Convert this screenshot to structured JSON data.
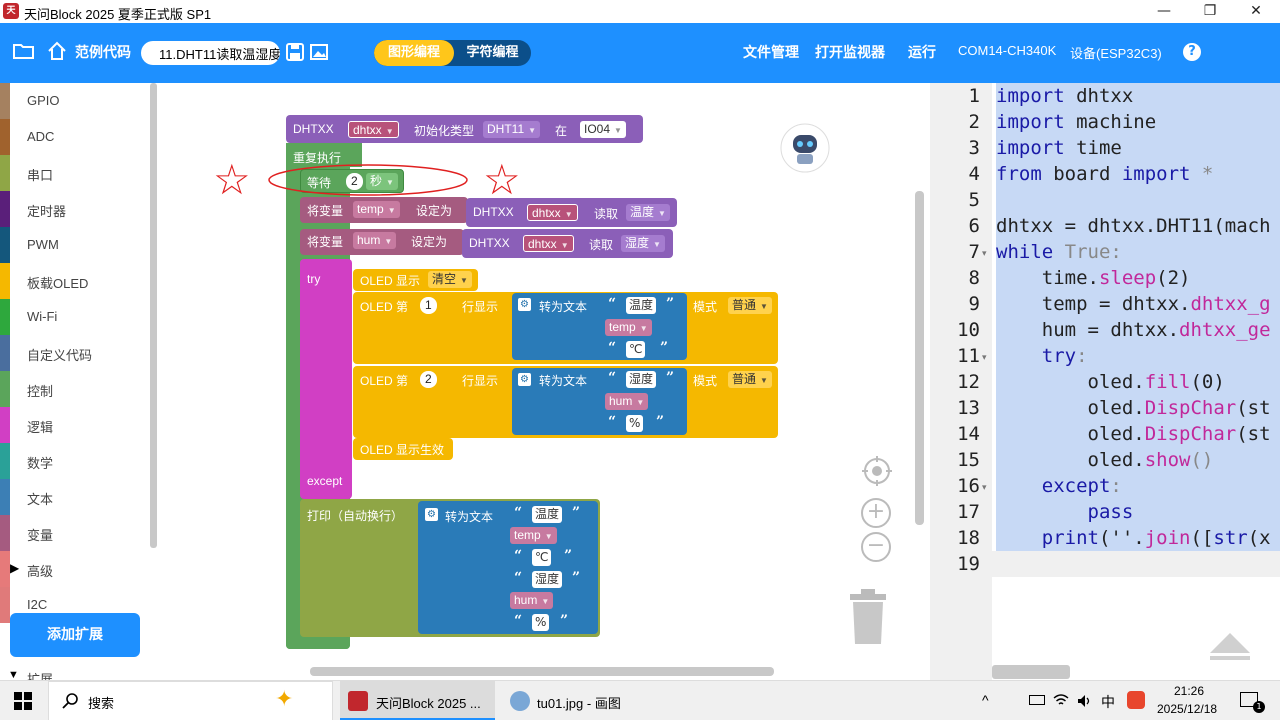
{
  "window": {
    "title": "天问Block 2025 夏季正式版 SP1",
    "logo_text": "天问",
    "minimize": "—",
    "restore": "❐",
    "close": "✕"
  },
  "toolbar": {
    "folder_icon": "folder-icon",
    "home_icon": "home-icon",
    "examples_label": "范例代码",
    "filename": "11.DHT11读取温湿度",
    "save_icon": "save-icon",
    "image_icon": "image-icon",
    "mode_graphic": "图形编程",
    "mode_text": "字符编程",
    "file_manage": "文件管理",
    "open_monitor": "打开监视器",
    "run": "运行",
    "port": "COM14-CH340K",
    "device": "设备(ESP32C3)",
    "help": "?"
  },
  "sidebar": {
    "items": [
      {
        "label": "GPIO",
        "color": "#a58160"
      },
      {
        "label": "ADC",
        "color": "#a0622d"
      },
      {
        "label": "串口",
        "color": "#8fa646"
      },
      {
        "label": "定时器",
        "color": "#5a1f7a"
      },
      {
        "label": "PWM",
        "color": "#14577c"
      },
      {
        "label": "板载OLED",
        "color": "#f5b800"
      },
      {
        "label": "Wi-Fi",
        "color": "#2ea83d"
      },
      {
        "label": "自定义代码",
        "color": "#4a6e9e"
      },
      {
        "label": "控制",
        "color": "#5ba55b"
      },
      {
        "label": "逻辑",
        "color": "#d13fc4"
      },
      {
        "label": "数学",
        "color": "#2aa198"
      },
      {
        "label": "文本",
        "color": "#3c7fb5"
      },
      {
        "label": "变量",
        "color": "#a55b80"
      },
      {
        "label": "高级",
        "color": "#e67a7a"
      },
      {
        "label": "I2C",
        "color": "#e07a7a"
      }
    ],
    "expand_marker": "▶",
    "add_extension": "添加扩展",
    "bottom_item": "扩展",
    "bottom_marker": "▼"
  },
  "blocks": {
    "init": {
      "label": "DHTXX",
      "var": "dhtxx",
      "type_label": "初始化类型",
      "type": "DHT11",
      "at": "在",
      "pin": "IO04"
    },
    "loop": {
      "label": "重复执行"
    },
    "wait": {
      "label": "等待",
      "value": "2",
      "unit": "秒"
    },
    "set1": {
      "label": "将变量",
      "var": "temp",
      "set_to": "设定为",
      "sensor": "DHTXX",
      "sensor_var": "dhtxx",
      "read": "读取",
      "what": "温度"
    },
    "set2": {
      "label": "将变量",
      "var": "hum",
      "set_to": "设定为",
      "sensor": "DHTXX",
      "sensor_var": "dhtxx",
      "read": "读取",
      "what": "湿度"
    },
    "try": {
      "label": "try",
      "except": "except"
    },
    "oled_clear": {
      "label": "OLED 显示",
      "value": "清空"
    },
    "oled_line1": {
      "label": "OLED 第",
      "line": "1",
      "row_display": "行显示",
      "to_text": "转为文本",
      "s1": "温度",
      "v": "temp",
      "s2": "℃",
      "mode_label": "模式",
      "mode": "普通"
    },
    "oled_line2": {
      "label": "OLED 第",
      "line": "2",
      "row_display": "行显示",
      "to_text": "转为文本",
      "s1": "湿度",
      "v": "hum",
      "s2": "%",
      "mode_label": "模式",
      "mode": "普通"
    },
    "oled_show": {
      "label": "OLED 显示生效"
    },
    "print": {
      "label": "打印（自动换行）",
      "to_text": "转为文本",
      "s1": "温度",
      "v1": "temp",
      "s2": "℃",
      "s3": "湿度",
      "v2": "hum",
      "s4": "%"
    }
  },
  "workspace_icons": {
    "robot": "robot-icon",
    "locate": "crosshair-icon",
    "zoom_in": "+",
    "zoom_out": "−",
    "trash": "trash-icon",
    "star": "☆"
  },
  "editor": {
    "lines": [
      {
        "n": "1",
        "fold": ""
      },
      {
        "n": "2",
        "fold": ""
      },
      {
        "n": "3",
        "fold": ""
      },
      {
        "n": "4",
        "fold": ""
      },
      {
        "n": "5",
        "fold": ""
      },
      {
        "n": "6",
        "fold": ""
      },
      {
        "n": "7",
        "fold": "▾"
      },
      {
        "n": "8",
        "fold": ""
      },
      {
        "n": "9",
        "fold": ""
      },
      {
        "n": "10",
        "fold": ""
      },
      {
        "n": "11",
        "fold": "▾"
      },
      {
        "n": "12",
        "fold": ""
      },
      {
        "n": "13",
        "fold": ""
      },
      {
        "n": "14",
        "fold": ""
      },
      {
        "n": "15",
        "fold": ""
      },
      {
        "n": "16",
        "fold": "▾"
      },
      {
        "n": "17",
        "fold": ""
      },
      {
        "n": "18",
        "fold": ""
      },
      {
        "n": "19",
        "fold": ""
      }
    ],
    "code": {
      "l1a": "import",
      "l1b": " dhtxx",
      "l2a": "import",
      "l2b": " machine",
      "l3a": "import",
      "l3b": " time",
      "l4a": "from",
      "l4b": " board ",
      "l4c": "import",
      "l4d": " *",
      "l6": "dhtxx = dhtxx.DHT11(mach",
      "l7a": "while",
      "l7b": " True:",
      "l8a": "    time.",
      "l8b": "sleep",
      "l8c": "(2)",
      "l9a": "    temp = dhtxx.",
      "l9b": "dhtxx_g",
      "l10a": "    hum = dhtxx.",
      "l10b": "dhtxx_ge",
      "l11a": "    ",
      "l11b": "try",
      "l12a": "        oled.",
      "l12b": "fill",
      "l12c": "(0)",
      "l13a": "        oled.",
      "l13b": "DispChar",
      "l13c": "(st",
      "l14a": "        oled.",
      "l14b": "DispChar",
      "l14c": "(st",
      "l15a": "        oled.",
      "l15b": "show",
      "l15c": "()",
      "l16a": "    ",
      "l16b": "except",
      "l16c": ":",
      "l17a": "        ",
      "l17b": "pass",
      "l18a": "    ",
      "l18b": "print",
      "l18c": "(''.",
      "l18d": "join",
      "l18e": "([",
      "l18f": "str",
      "l18g": "(x"
    }
  },
  "taskbar": {
    "search": "搜索",
    "app1": "天问Block 2025 ...",
    "app2": "tu01.jpg - 画图",
    "ime": "中",
    "time": "21:26",
    "date": "2025/12/18",
    "notif_count": "1"
  }
}
